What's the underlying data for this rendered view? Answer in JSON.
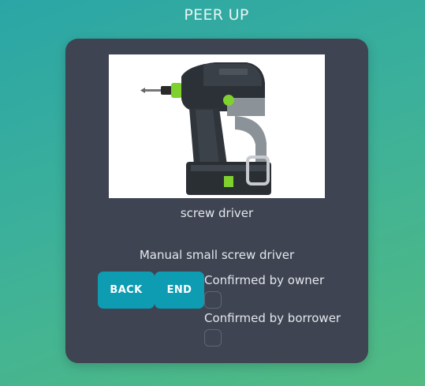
{
  "app": {
    "title": "PEER UP"
  },
  "item": {
    "name": "screw driver",
    "description": "Manual small screw driver",
    "image_subject": "cordless-drill"
  },
  "actions": {
    "back_label": "BACK",
    "end_label": "END"
  },
  "confirmations": {
    "owner_label": "Confirmed by owner",
    "owner_checked": false,
    "borrower_label": "Confirmed by borrower",
    "borrower_checked": false
  },
  "colors": {
    "background_start": "#2ba6a6",
    "background_end": "#52bb82",
    "card": "#3e4451",
    "button": "#0e9cb3",
    "text": "#e4e7ee"
  }
}
